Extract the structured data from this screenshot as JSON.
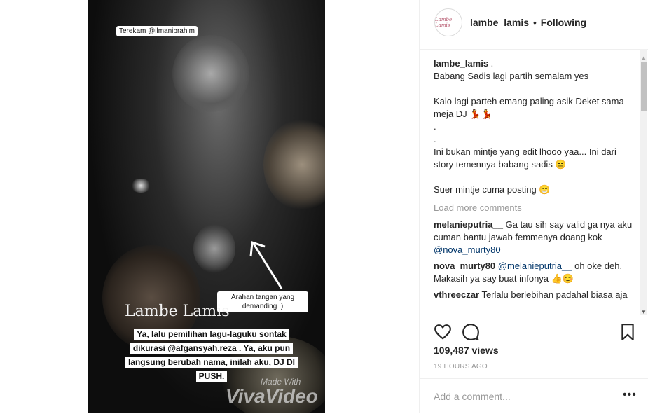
{
  "video": {
    "tag_top": "Terekam @ilmanibrahim",
    "watermark": "Lambe Lamis",
    "arrow_tag": "Arahan tangan yang demanding :)",
    "caption": "Ya, lalu pemilihan lagu-laguku sontak dikurasi @afgansyah.reza . Ya, aku pun langsung berubah nama, inilah aku, DJ DI PUSH.",
    "made_with": "Made With",
    "vivavideo": "VivaVideo"
  },
  "header": {
    "avatar_text": "Lambe Lamis",
    "username": "lambe_lamis",
    "separator": "•",
    "follow_status": "Following"
  },
  "post_caption": {
    "username": "lambe_lamis",
    "lines": "Babang Sadis lagi partih semalam yes\n\nKalo lagi parteh emang paling asik Deket sama meja DJ 💃💃\n.\n.\nIni bukan mintje yang edit lhooo yaa... Ini dari story temennya babang sadis 😑\n\nSuer mintje cuma posting 😁",
    "lead": "."
  },
  "load_more": "Load more comments",
  "comments": [
    {
      "user": "melanieputria__",
      "text": "Ga tau sih say valid ga nya aku cuman bantu jawab femmenya doang kok",
      "mention": "@nova_murty80"
    },
    {
      "user": "nova_murty80",
      "mention": "@melanieputria__",
      "text": "oh oke deh. Makasih ya say buat infonya 👍😊"
    },
    {
      "user": "vthreeczar",
      "text": "Terlalu berlebihan padahal biasa aja"
    }
  ],
  "stats": {
    "views": "109,487 views",
    "time": "19 HOURS AGO"
  },
  "add_comment": {
    "placeholder": "Add a comment...",
    "more": "•••"
  },
  "colors": {
    "mention": "#003569",
    "muted": "#999999",
    "text": "#262626"
  }
}
